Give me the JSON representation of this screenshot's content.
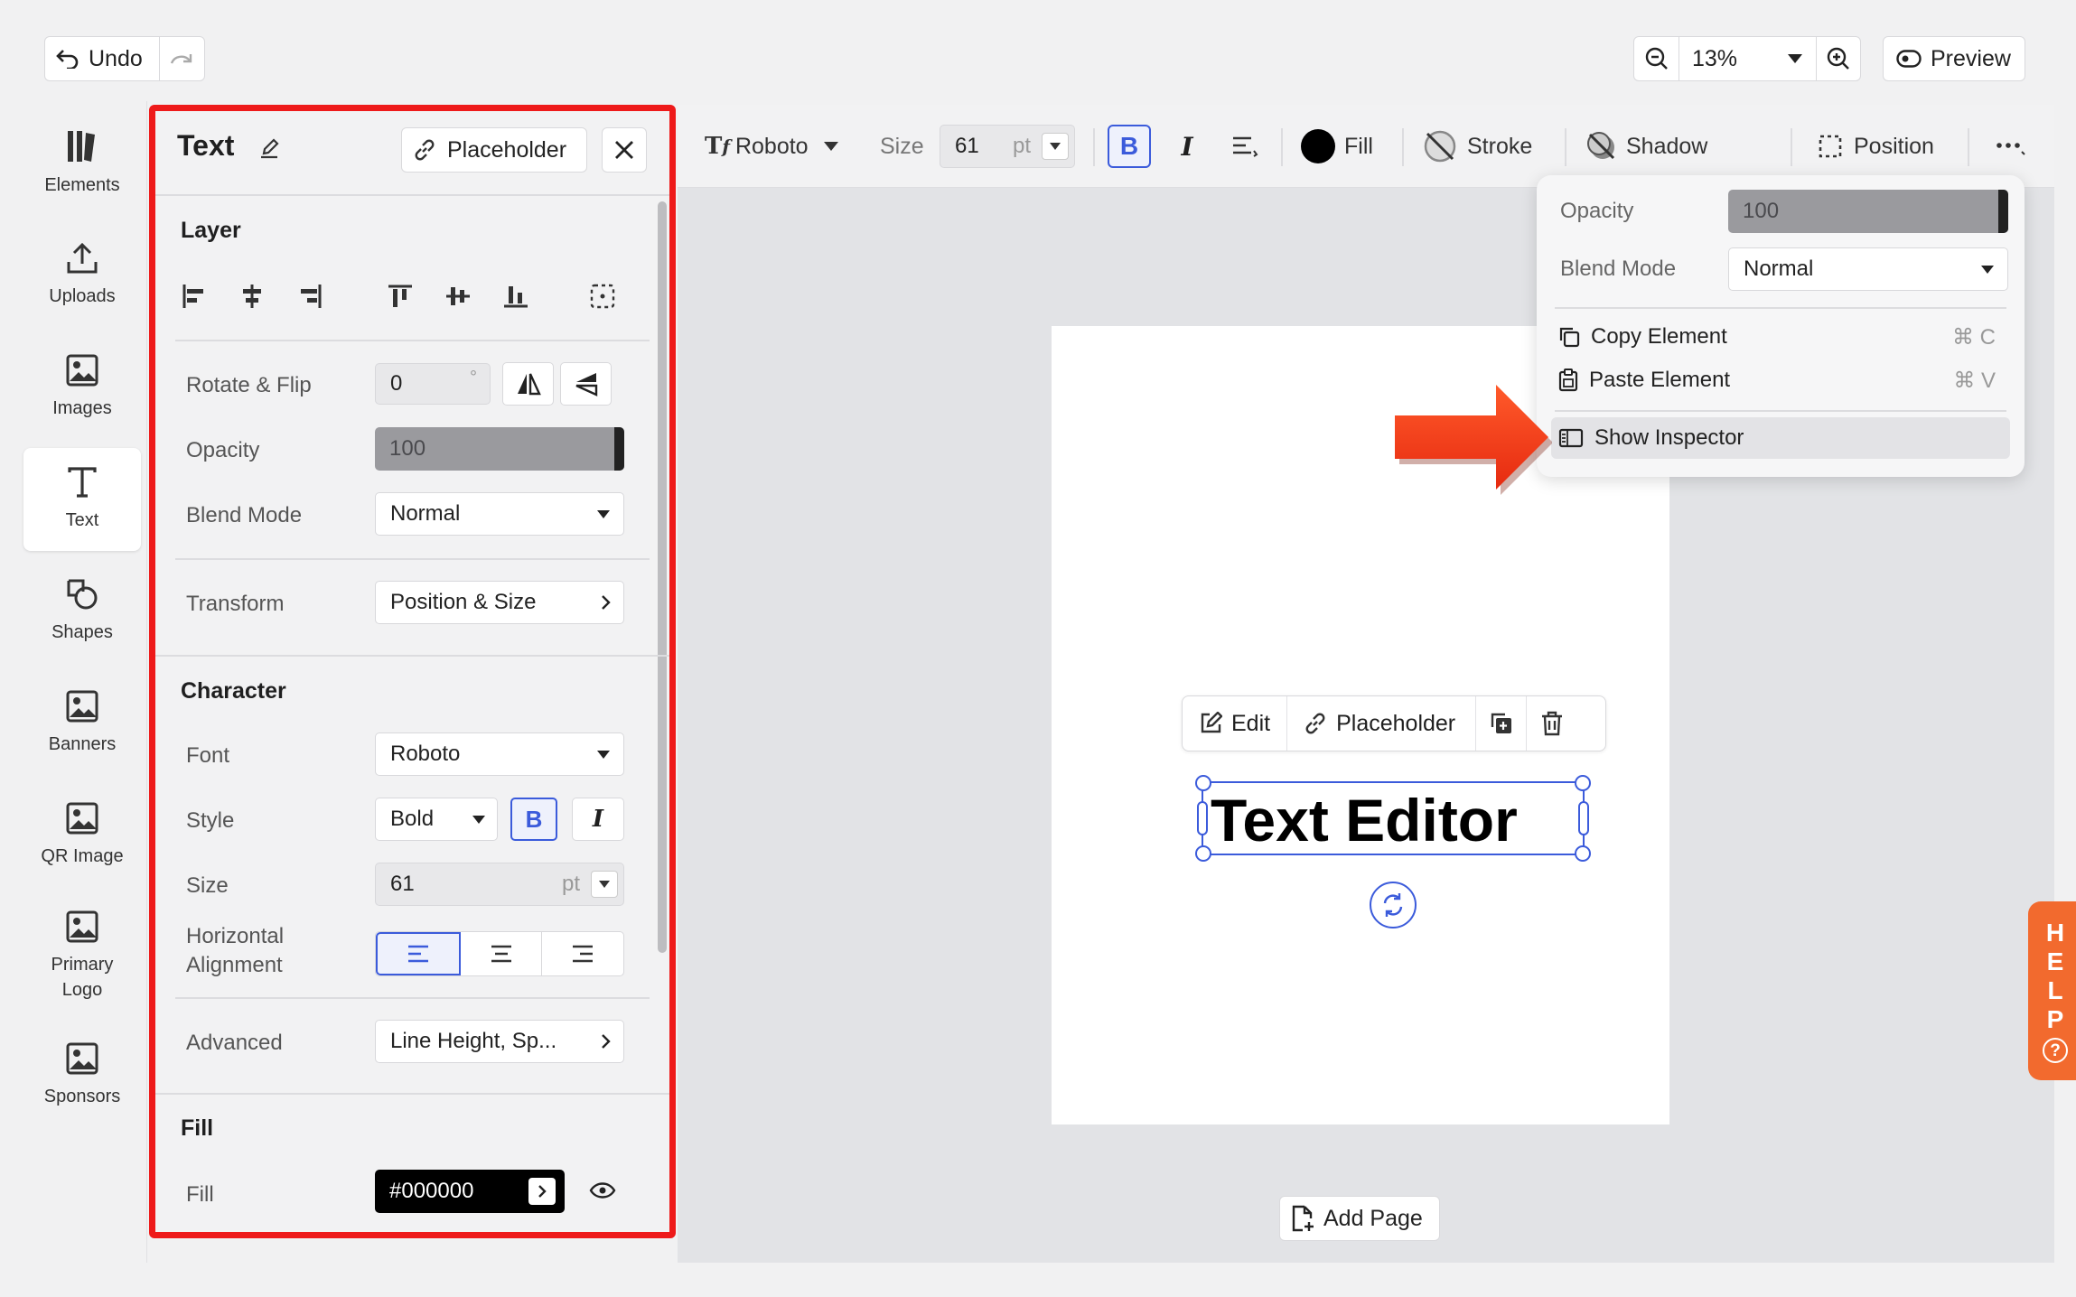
{
  "topbar": {
    "undo_label": "Undo",
    "zoom_value": "13%",
    "preview_label": "Preview"
  },
  "rail": {
    "items": [
      {
        "label": "Elements"
      },
      {
        "label": "Uploads"
      },
      {
        "label": "Images"
      },
      {
        "label": "Text"
      },
      {
        "label": "Shapes"
      },
      {
        "label": "Banners"
      },
      {
        "label": "QR Image"
      },
      {
        "label": "Primary Logo"
      },
      {
        "label": "Sponsors"
      }
    ]
  },
  "panel": {
    "title": "Text",
    "placeholder_label": "Placeholder",
    "layer": {
      "title": "Layer",
      "rotate_label": "Rotate & Flip",
      "rotate_value": "0",
      "rotate_unit": "°",
      "opacity_label": "Opacity",
      "opacity_value": "100",
      "blend_label": "Blend Mode",
      "blend_value": "Normal",
      "transform_label": "Transform",
      "transform_value": "Position & Size"
    },
    "character": {
      "title": "Character",
      "font_label": "Font",
      "font_value": "Roboto",
      "style_label": "Style",
      "style_value": "Bold",
      "bold_glyph": "B",
      "italic_glyph": "I",
      "size_label": "Size",
      "size_value": "61",
      "size_unit": "pt",
      "halign_label": "Horizontal Alignment",
      "advanced_label": "Advanced",
      "advanced_value": "Line Height, Sp..."
    },
    "fill": {
      "title": "Fill",
      "fill_label": "Fill",
      "fill_value": "#000000"
    }
  },
  "toolbar": {
    "font": "Roboto",
    "size_label": "Size",
    "size_value": "61",
    "size_unit": "pt",
    "bold_glyph": "B",
    "italic_glyph": "I",
    "fill_label": "Fill",
    "stroke_label": "Stroke",
    "shadow_label": "Shadow",
    "position_label": "Position"
  },
  "menu": {
    "opacity_label": "Opacity",
    "opacity_value": "100",
    "blend_label": "Blend Mode",
    "blend_value": "Normal",
    "copy_label": "Copy Element",
    "copy_key": "⌘ C",
    "paste_label": "Paste Element",
    "paste_key": "⌘ V",
    "inspector_label": "Show Inspector"
  },
  "canvas": {
    "edit_label": "Edit",
    "placeholder_label": "Placeholder",
    "text_content": "Text Editor",
    "add_page_label": "Add Page"
  },
  "help": {
    "letters": [
      "H",
      "E",
      "L",
      "P"
    ],
    "glyph": "?"
  },
  "colors": {
    "highlight_border": "#ee1a1a",
    "accent": "#3b5bdb",
    "help_bg": "#f26a2e",
    "arrow": "#ff3b1a"
  }
}
